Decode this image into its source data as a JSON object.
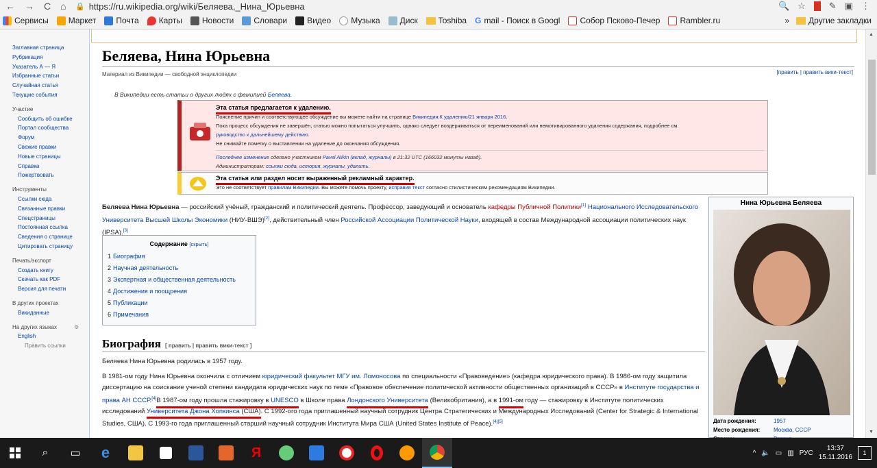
{
  "browser": {
    "url": "https://ru.wikipedia.org/wiki/Беляева,_Нина_Юрьевна",
    "bookmarks": [
      "Сервисы",
      "Маркет",
      "Почта",
      "Карты",
      "Новости",
      "Словари",
      "Видео",
      "Музыка",
      "Диск",
      "Toshiba",
      "mail - Поиск в Googl",
      "Собор Псково-Печер",
      "Rambler.ru"
    ],
    "more": "»",
    "other_bookmarks": "Другие закладки",
    "nav_back": "←",
    "nav_forward": "→",
    "nav_reload": "C",
    "nav_home": "⌂"
  },
  "sidebar": {
    "main": [
      "Заглавная страница",
      "Рубрикация",
      "Указатель А — Я",
      "Избранные статьи",
      "Случайная статья",
      "Текущие события"
    ],
    "participation_title": "Участие",
    "participation": [
      "Сообщить об ошибке",
      "Портал сообщества",
      "Форум",
      "Свежие правки",
      "Новые страницы",
      "Справка",
      "Пожертвовать"
    ],
    "tools_title": "Инструменты",
    "tools": [
      "Ссылки сюда",
      "Связанные правки",
      "Спецстраницы",
      "Постоянная ссылка",
      "Сведения о странице",
      "Цитировать страницу"
    ],
    "print_title": "Печать/экспорт",
    "print": [
      "Создать книгу",
      "Скачать как PDF",
      "Версия для печати"
    ],
    "projects_title": "В других проектах",
    "projects": [
      "Викиданные"
    ],
    "langs_title": "На других языках",
    "langs": [
      "English"
    ],
    "edit_links": "Править ссылки"
  },
  "article": {
    "title": "Беляева, Нина Юрьевна",
    "from": "Материал из Википедии — свободной энциклопедии",
    "edit_links": "[править | править вики-текст]",
    "hatnote_pre": "В Википедии есть статьи о других людях с фамилией ",
    "hatnote_link": "Беляева",
    "hatnote_post": ".",
    "deletion": {
      "title": "Эта статья предлагается к удалению.",
      "line1_pre": "Пояснение причин и соответствующее обсуждение вы можете найти на странице ",
      "line1_link": "Википедия:К удалению/21 января 2016",
      "line1_post": ".",
      "line2": "Пока процесс обсуждения не завершён, статью можно попытаться улучшить, однако следует воздерживаться от переименований или немотивированного удаления содержания, подробнее см.",
      "line3": "руководство к дальнейшему действию.",
      "line4": "Не снимайте пометку о выставлении на удаление до окончания обсуждения.",
      "last_change_link": "Последнее изменение",
      "last_change_mid": " сделано участником ",
      "last_change_user": "Pavel Alikin (вклад, журналы)",
      "last_change_time": " в 21:32 UTC (166032 минуты назад).",
      "admins_label": "Администраторам: ",
      "admins_links": "ссылки сюда, история, журналы, удалить."
    },
    "ad": {
      "title": "Эта статья или раздел носит выраженный рекламный характер.",
      "line_pre": "Это не соответствует ",
      "line_link1": "правилам Википедии",
      "line_mid": ". Вы можете помочь проекту, ",
      "line_link2": "исправив текст",
      "line_post": " согласно стилистическим рекомендациям Википедии."
    },
    "lead": {
      "name": "Беляева Нина Юрьевна",
      "t1": " — российский учёный, гражданский и политический деятель. Профессор, заведующий и основатель ",
      "l1": "кафедры Публичной Политики",
      "r1": "[1]",
      "t2": " ",
      "l2": "Национального Исследовательского Университета Высшей Школы Экономики",
      "t3": " (НИУ-ВШЭ)",
      "r2": "[2]",
      "t4": ", действительный член ",
      "l3": "Российской Ассоциации Политической Науки",
      "t5": ", входящей в состав Международной ассоциации политических наук (IPSA).",
      "r3": "[3]"
    },
    "toc": {
      "title": "Содержание",
      "hide": "[скрыть]",
      "items": [
        {
          "n": "1",
          "t": "Биография"
        },
        {
          "n": "2",
          "t": "Научная деятельность"
        },
        {
          "n": "3",
          "t": "Экспертная и общественная деятельность"
        },
        {
          "n": "4",
          "t": "Достижения и поощрения"
        },
        {
          "n": "5",
          "t": "Публикации"
        },
        {
          "n": "6",
          "t": "Примечания"
        }
      ]
    },
    "bio_heading": "Биография",
    "bio_edit": "[ править | править вики-текст ]",
    "bio_p1": "Беляева Нина Юрьевна родилась в 1957 году.",
    "bio_p2": {
      "t1": "В 1981-ом году Нина Юрьевна окончила с отличием ",
      "l1": "юридический факультет МГУ им. Ломоносова",
      "t2": " по специальности «Правоведение» (кафедра юридического права). В 1986-ом году защитила диссертацию на соискание ученой степени кандидата юридических наук по теме «Правовое обеспечение политической активности общественных организаций в СССР» в ",
      "l2": "Институте государства и права АН СССР",
      "r1": "[4]",
      "t3": " В 1987-ом году прошла стажировку в ",
      "l3": "UNESCO",
      "t4": " в Школе права ",
      "l4": "Лондонского Университета",
      "t5": " (Великобритания), а в ",
      "t5b": "1991-ом",
      "t6": " году — стажировку в Институте политических исследований ",
      "l5": "Университета Джона Хопкинса",
      "t7": " (США)",
      "t8": ". С 1992-ого года приглашенный научный сотрудник Центра Стратегических и Международных Исследований (Center for Strategic & International Studies, США). С 1993-го года приглашенный старший научный сотрудник Института Мира США (United States Institute of Peace).",
      "r2": "[4]",
      "r3": "[5]",
      "t9": "."
    }
  },
  "infobox": {
    "title": "Нина Юрьевна Беляева",
    "rows": [
      {
        "k": "Дата рождения:",
        "v": "1957"
      },
      {
        "k": "Место рождения:",
        "v": "Москва, СССР"
      },
      {
        "k": "Страна:",
        "v": "Россия"
      }
    ]
  },
  "taskbar": {
    "lang": "РУС",
    "time": "13:37",
    "date": "15.11.2016",
    "notifications": "1"
  },
  "colors": {
    "link": "#0645ad",
    "redlink": "#ba0000",
    "deletion_bg": "#fee7e6",
    "deletion_border": "#b32424",
    "ad_border": "#ffcc33",
    "underline": "#dd0000"
  }
}
